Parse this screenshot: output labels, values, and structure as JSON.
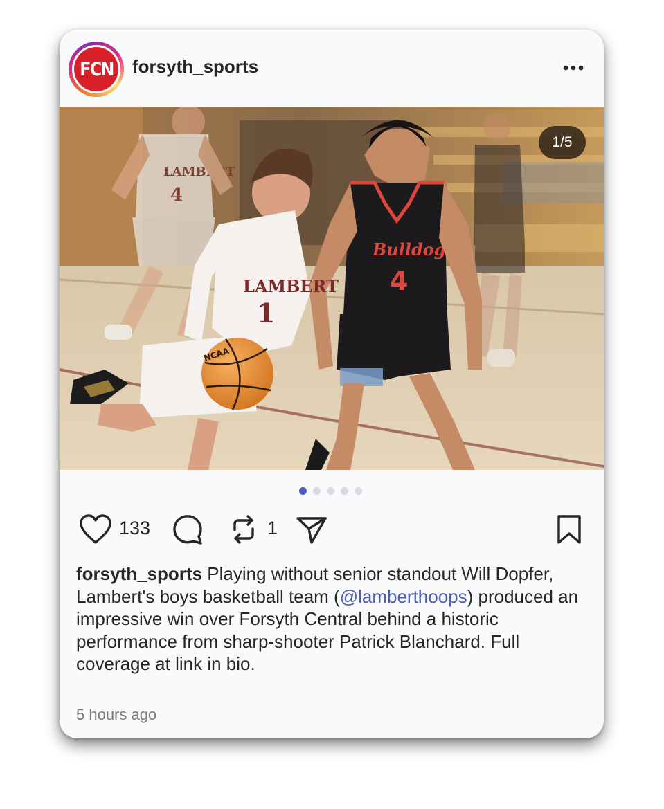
{
  "post": {
    "username": "forsyth_sports",
    "avatar_text": "FCN",
    "image_counter": "1/5",
    "carousel": {
      "total": 5,
      "active_index": 0
    },
    "jersey_left": "LAMBERT",
    "jersey_left_number": "1",
    "jersey_right": "Bulldogs",
    "jersey_right_number": "4",
    "bg_player_jersey": "LAMBERT",
    "bg_player_number": "4",
    "ball_text": "NCAA",
    "likes": "133",
    "reposts": "1",
    "caption": {
      "username": "forsyth_sports",
      "text_part1": " Playing without senior standout Will Dopfer, Lambert's boys basketball team (",
      "mention": "@lamberthoops",
      "text_part2": ") produced an impressive win over Forsyth Central behind a historic performance from sharp-shooter Patrick Blanchard. Full coverage at link in bio."
    },
    "timestamp": "5 hours ago"
  },
  "icons": {
    "more": "more-icon",
    "like": "heart-icon",
    "comment": "comment-icon",
    "repost": "repost-icon",
    "share": "share-icon",
    "save": "bookmark-icon"
  },
  "colors": {
    "brand_red": "#d8202a",
    "mention": "#4c5cb8",
    "active_dot": "#4c5cb8",
    "timestamp": "#7a7a7a"
  }
}
